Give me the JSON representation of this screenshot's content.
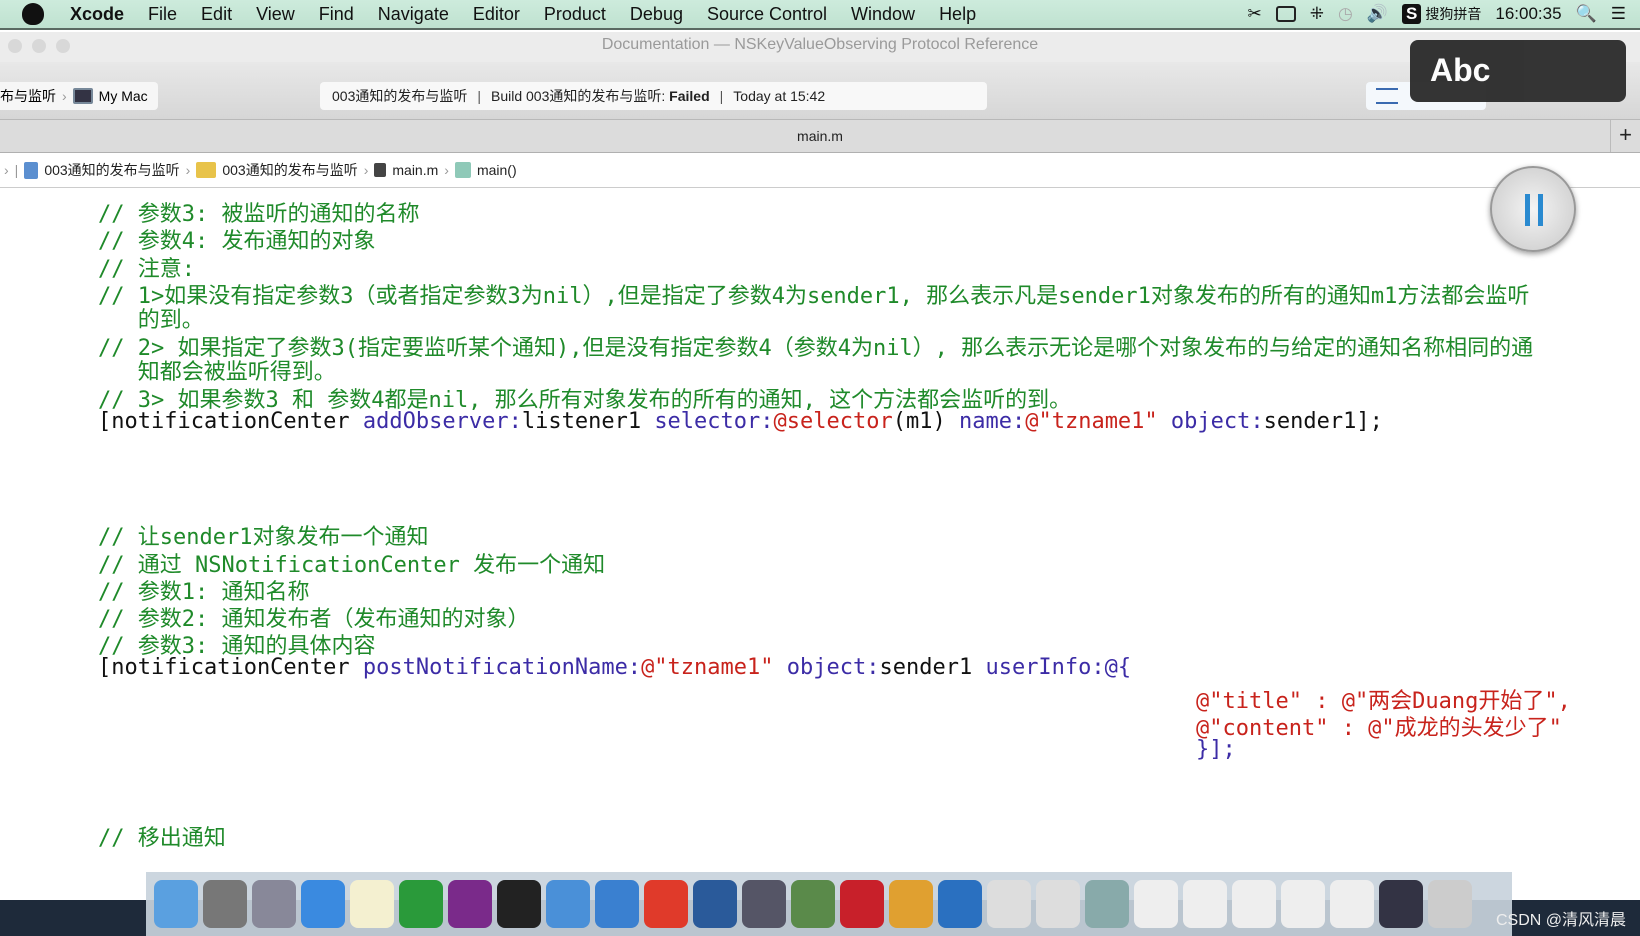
{
  "menubar": {
    "app": "Xcode",
    "items": [
      "File",
      "Edit",
      "View",
      "Find",
      "Navigate",
      "Editor",
      "Product",
      "Debug",
      "Source Control",
      "Window",
      "Help"
    ],
    "ime": "搜狗拼音",
    "clock": "16:00:35"
  },
  "window": {
    "title": "Documentation — NSKeyValueObserving Protocol Reference"
  },
  "toolbar": {
    "scheme_target": "布与监听",
    "destination": "My Mac",
    "status_project": "003通知的发布与监听",
    "status_build": "Build 003通知的发布与监听:",
    "status_result": "Failed",
    "status_time": "Today at 15:42"
  },
  "overlay": {
    "input_mode": "Abc"
  },
  "tabbar": {
    "tab": "main.m",
    "add": "+"
  },
  "jumpbar": {
    "items": [
      "003通知的发布与监听",
      "003通知的发布与监听",
      "main.m",
      "main()"
    ]
  },
  "colors": {
    "comment": "#1f8a2a",
    "method": "#3c2ca6",
    "string": "#c8231c"
  },
  "code": [
    [
      [
        "// 参数3: 被监听的通知的名称",
        "c"
      ]
    ],
    [
      [
        "// 参数4: 发布通知的对象",
        "c"
      ]
    ],
    [
      [
        "// 注意:",
        "c"
      ]
    ],
    [
      [
        "// 1>如果没有指定参数3（或者指定参数3为nil）,但是指定了参数4为sender1, 那么表示凡是sender1对象发布的所有的通知m1方法都会监听",
        "c"
      ]
    ],
    [
      [
        "   的到。",
        "c"
      ]
    ],
    [
      [
        "// 2> 如果指定了参数3(指定要监听某个通知),但是没有指定参数4（参数4为nil）, 那么表示无论是哪个对象发布的与给定的通知名称相同的通",
        "c"
      ]
    ],
    [
      [
        "   知都会被监听得到。",
        "c"
      ]
    ],
    [
      [
        "// 3> 如果参数3 和 参数4都是nil, 那么所有对象发布的所有的通知, 这个方法都会监听的到。",
        "c"
      ]
    ],
    [
      [
        "[notificationCenter ",
        "p"
      ],
      [
        "addObserver:",
        "m"
      ],
      [
        "listener1 ",
        "p"
      ],
      [
        "selector:",
        "m"
      ],
      [
        "@selector",
        "k"
      ],
      [
        "(m1) ",
        "p"
      ],
      [
        "name:",
        "m"
      ],
      [
        "@\"tzname1\"",
        "s"
      ],
      [
        " ",
        "p"
      ],
      [
        "object:",
        "m"
      ],
      [
        "sender1];",
        "p"
      ]
    ],
    [
      [
        "// 让sender1对象发布一个通知",
        "c"
      ]
    ],
    [
      [
        "// 通过 NSNotificationCenter 发布一个通知",
        "c"
      ]
    ],
    [
      [
        "// 参数1: 通知名称",
        "c"
      ]
    ],
    [
      [
        "// 参数2: 通知发布者（发布通知的对象）",
        "c"
      ]
    ],
    [
      [
        "// 参数3: 通知的具体内容",
        "c"
      ]
    ],
    [
      [
        "[notificationCenter ",
        "p"
      ],
      [
        "postNotificationName:",
        "m"
      ],
      [
        "@\"tzname1\"",
        "s"
      ],
      [
        " ",
        "p"
      ],
      [
        "object:",
        "m"
      ],
      [
        "sender1 ",
        "p"
      ],
      [
        "userInfo:",
        "m"
      ],
      [
        "@{",
        "m"
      ]
    ],
    [
      [
        "@\"title\" : @\"两会Duang开始了\",",
        "s"
      ]
    ],
    [
      [
        "@\"content\" : @\"成龙的头发少了\"",
        "s"
      ]
    ],
    [
      [
        "}];",
        "m"
      ]
    ],
    [
      [
        "// 移出通知",
        "c"
      ]
    ]
  ],
  "watermark": "CSDN @清风清晨"
}
